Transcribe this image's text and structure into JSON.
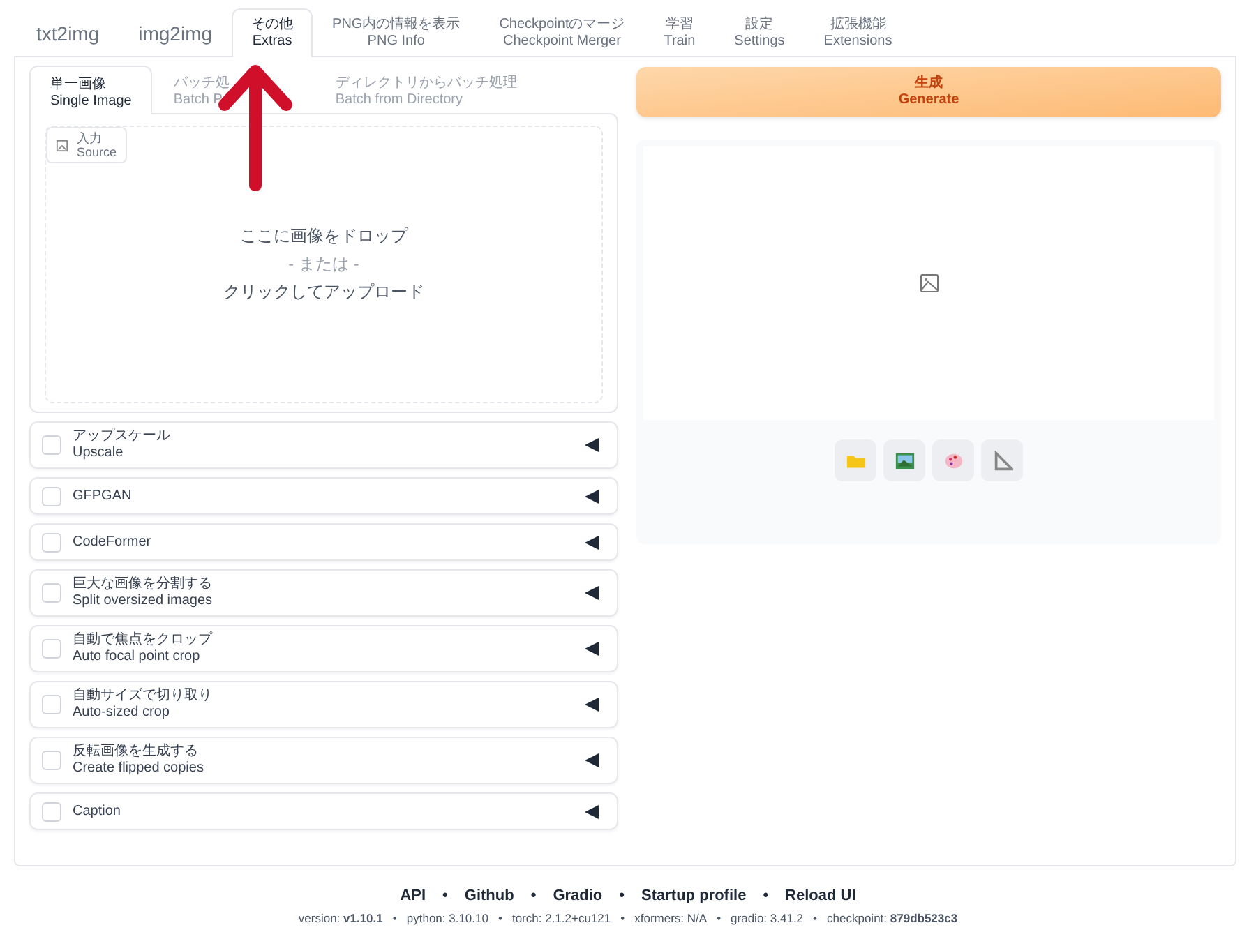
{
  "top_tabs": [
    {
      "label": "txt2img",
      "selected": false
    },
    {
      "label": "img2img",
      "selected": false
    },
    {
      "label": "その他",
      "sublabel": "Extras",
      "selected": true
    },
    {
      "label": "PNG内の情報を表示",
      "sublabel": "PNG Info",
      "selected": false
    },
    {
      "label": "Checkpointのマージ",
      "sublabel": "Checkpoint Merger",
      "selected": false
    },
    {
      "label": "学習",
      "sublabel": "Train",
      "selected": false
    },
    {
      "label": "設定",
      "sublabel": "Settings",
      "selected": false
    },
    {
      "label": "拡張機能",
      "sublabel": "Extensions",
      "selected": false
    }
  ],
  "sub_tabs": [
    {
      "label": "単一画像",
      "sublabel": "Single Image",
      "selected": true
    },
    {
      "label": "バッチ処",
      "sublabel": "Batch P",
      "selected": false
    },
    {
      "label": "ディレクトリからバッチ処理",
      "sublabel": "Batch from Directory",
      "selected": false
    }
  ],
  "source": {
    "label": "入力",
    "sublabel": "Source",
    "drop_lines": [
      "ここに画像をドロップ",
      "- または -",
      "クリックしてアップロード"
    ]
  },
  "accordions": [
    {
      "label": "アップスケール",
      "sublabel": "Upscale",
      "checked": false,
      "expanded": false
    },
    {
      "label": "GFPGAN",
      "checked": false,
      "expanded": false
    },
    {
      "label": "CodeFormer",
      "checked": false,
      "expanded": false
    },
    {
      "label": "巨大な画像を分割する",
      "sublabel": "Split oversized images",
      "checked": false,
      "expanded": false
    },
    {
      "label": "自動で焦点をクロップ",
      "sublabel": "Auto focal point crop",
      "checked": false,
      "expanded": false
    },
    {
      "label": "自動サイズで切り取り",
      "sublabel": "Auto-sized crop",
      "checked": false,
      "expanded": false
    },
    {
      "label": "反転画像を生成する",
      "sublabel": "Create flipped copies",
      "checked": false,
      "expanded": false
    },
    {
      "label": "Caption",
      "checked": false,
      "expanded": false
    }
  ],
  "generate_button": {
    "label": "生成",
    "sublabel": "Generate"
  },
  "gallery_tools": [
    {
      "kind": "folder"
    },
    {
      "kind": "image"
    },
    {
      "kind": "palette"
    },
    {
      "kind": "ruler"
    }
  ],
  "footer": {
    "separator": "•",
    "links": [
      "API",
      "Github",
      "Gradio",
      "Startup profile",
      "Reload UI"
    ],
    "versions": [
      "version: **v1.10.1**",
      "python: 3.10.10",
      "torch: 2.1.2+cu121",
      "xformers: N/A",
      "gradio: 3.41.2",
      "checkpoint: **879db523c3**"
    ]
  },
  "annotation": {
    "kind": "arrow"
  }
}
